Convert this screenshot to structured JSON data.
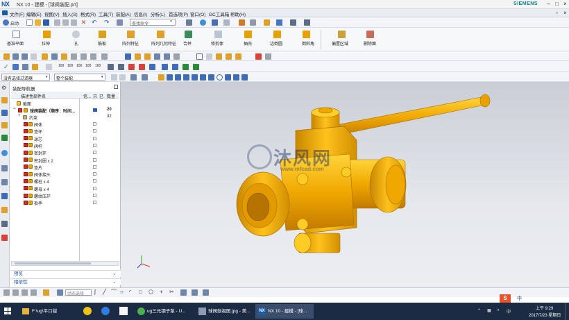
{
  "window": {
    "title": "NX 10 - 建模 - [球阀装配.prt]",
    "logo": "NX",
    "brand": "SIEMENS",
    "min": "–",
    "restore": "□",
    "close": "×",
    "sub_restore": "▫",
    "sub_close": "×"
  },
  "menu": [
    "文件(F)",
    "编辑(E)",
    "视图(V)",
    "插入(S)",
    "格式(R)",
    "工具(T)",
    "装配(A)",
    "信息(I)",
    "分析(L)",
    "首选项(P)",
    "窗口(O)",
    "GC工具箱",
    "帮助(H)"
  ],
  "toolbar1": {
    "start_label": "启动·",
    "search_placeholder": "查找命令"
  },
  "ribbon": [
    "基准平面",
    "拉伸",
    "孔",
    "筋板",
    "阵列特征",
    "阵列几何特征",
    "合并",
    "修剪体",
    "抽壳",
    "边倒圆",
    "倒斜角",
    "偏置区域",
    "删除面"
  ],
  "numeric_buttons": [
    "100",
    "100",
    "100",
    "100",
    "100"
  ],
  "filters": {
    "type_filter": "没有选择过滤器",
    "assembly_filter": "整个装配"
  },
  "navigator": {
    "title": "装配导航器",
    "columns": [
      "描述性部件名",
      "信...",
      "只",
      "已",
      "数量"
    ],
    "rows": [
      {
        "label": "截面",
        "indent": 0,
        "qty": ""
      },
      {
        "label": "球阀装配（顺序：时间...",
        "indent": 1,
        "qty": "20"
      },
      {
        "label": "约束",
        "indent": 2,
        "qty": "32"
      },
      {
        "label": "阀体",
        "indent": 3,
        "qty": ""
      },
      {
        "label": "垫环",
        "indent": 3,
        "qty": ""
      },
      {
        "label": "球芯",
        "indent": 3,
        "qty": ""
      },
      {
        "label": "阀杆",
        "indent": 3,
        "qty": ""
      },
      {
        "label": "密封环",
        "indent": 3,
        "qty": ""
      },
      {
        "label": "密封圈 x 2",
        "indent": 3,
        "qty": ""
      },
      {
        "label": "垫片",
        "indent": 3,
        "qty": ""
      },
      {
        "label": "阀体接头",
        "indent": 3,
        "qty": ""
      },
      {
        "label": "螺柱 x 4",
        "indent": 3,
        "qty": ""
      },
      {
        "label": "螺母 x 4",
        "indent": 3,
        "qty": ""
      },
      {
        "label": "螺纹压环",
        "indent": 3,
        "qty": ""
      },
      {
        "label": "扳手",
        "indent": 3,
        "qty": ""
      }
    ],
    "sections": [
      "预览",
      "相依性"
    ]
  },
  "watermark": {
    "main": "沐风网",
    "sub": "www.mfcad.com"
  },
  "bottom_search": "动态选择",
  "taskbar": {
    "items": [
      "F:\\ug\\平口钳",
      "ug三元钢子泵 - U...",
      "球阀剖视图.jpg - 美...",
      "NX 10 - 建模 - [球..."
    ],
    "time": "上午 9:29",
    "date": "2017/7/23 星期日",
    "ime": "中"
  },
  "colors": {
    "accent": "#1f4fa8",
    "part": "#f0a800",
    "taskbar": "#1c2b44"
  }
}
